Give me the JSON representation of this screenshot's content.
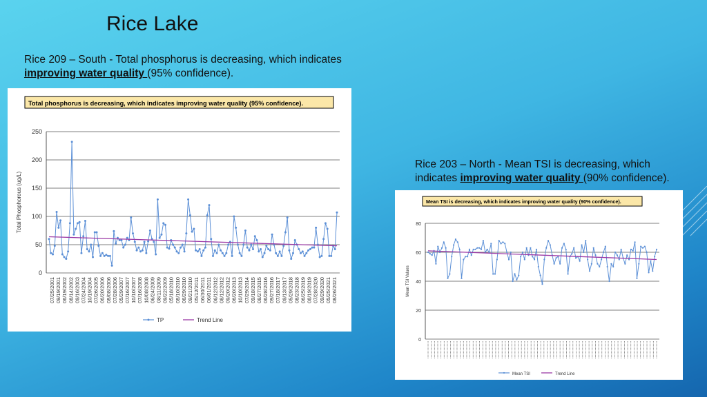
{
  "title": "Rice Lake",
  "caption_left": {
    "prefix": "Rice 209 – South - Total phosphorus is decreasing, which indicates ",
    "emphasis": "improving water quality ",
    "suffix": "(95% confidence)."
  },
  "caption_right": {
    "prefix": "Rice 203 – North - Mean TSI is decreasing, which indicates ",
    "emphasis": "improving water quality ",
    "suffix": "(90% confidence)."
  },
  "colors": {
    "series": "#5b8fd6",
    "trend": "#9b3aa6",
    "grid": "#555555",
    "box_fill": "#fbe7a8"
  },
  "chart_data": [
    {
      "type": "line",
      "title": "Total phosphorus is decreasing, which indicates improving water quality (95% confidence).",
      "ylabel": "Total Phosphorous (ug/L)",
      "xlabel": "",
      "ylim": [
        0,
        250
      ],
      "yticks": [
        0,
        50,
        100,
        150,
        200,
        250
      ],
      "grid": true,
      "legend_position": "bottom",
      "categories": [
        "07/25/2001",
        "09/19/2001",
        "06/19/2002",
        "08/14/2002",
        "09/16/2003",
        "07/24/2004",
        "10/19/2004",
        "07/26/2005",
        "06/20/2006",
        "08/08/2006",
        "07/28/2006",
        "05/29/2007",
        "07/16/2007",
        "10/10/2007",
        "07/16/2008",
        "10/08/2008",
        "06/24/2009",
        "08/11/2009",
        "09/22/2009",
        "05/18/2010",
        "08/10/2010",
        "06/29/2010",
        "09/21/2010",
        "05/12/2011",
        "06/30/2011",
        "06/01/2011",
        "06/12/2012",
        "08/12/2012",
        "09/20/2012",
        "06/20/2013",
        "10/10/2013",
        "07/29/2014",
        "09/18/2015",
        "08/27/2015",
        "06/28/2016",
        "09/27/2016",
        "07/18/2017",
        "09/13/2017",
        "05/29/2018",
        "08/23/2018",
        "06/25/2019",
        "08/19/2019",
        "07/28/2020",
        "09/29/2020",
        "05/25/2021",
        "08/26/2021"
      ],
      "series": [
        {
          "name": "TP",
          "values": [
            60,
            35,
            33,
            48,
            108,
            80,
            93,
            33,
            28,
            25,
            38,
            88,
            232,
            68,
            78,
            88,
            90,
            35,
            65,
            92,
            42,
            38,
            50,
            28,
            72,
            72,
            48,
            30,
            35,
            30,
            32,
            30,
            30,
            13,
            74,
            52,
            62,
            58,
            58,
            45,
            50,
            62,
            58,
            98,
            70,
            55,
            40,
            45,
            38,
            40,
            55,
            35,
            56,
            75,
            60,
            55,
            33,
            130,
            62,
            68,
            88,
            85,
            45,
            43,
            58,
            50,
            45,
            38,
            35,
            45,
            50,
            38,
            70,
            130,
            102,
            73,
            78,
            40,
            38,
            42,
            30,
            40,
            45,
            102,
            120,
            60,
            30,
            40,
            35,
            50,
            40,
            35,
            30,
            35,
            50,
            55,
            30,
            100,
            80,
            50,
            35,
            30,
            50,
            75,
            45,
            40,
            50,
            42,
            65,
            58,
            38,
            42,
            28,
            35,
            48,
            42,
            40,
            68,
            50,
            35,
            30,
            38,
            30,
            48,
            72,
            98,
            40,
            25,
            35,
            58,
            50,
            42,
            35,
            38,
            30,
            35,
            40,
            42,
            45,
            45,
            80,
            50,
            28,
            30,
            60,
            88,
            78,
            30,
            30,
            48,
            42,
            107
          ]
        },
        {
          "name": "Trend Line",
          "values": [
            64,
            48
          ]
        }
      ]
    },
    {
      "type": "line",
      "title": "Mean TSI is decreasing, which indicates improving water quality (90% confidence).",
      "ylabel": "Mean TSI Values",
      "xlabel": "",
      "ylim": [
        0,
        80
      ],
      "yticks": [
        0,
        20,
        40,
        60,
        80
      ],
      "grid": true,
      "legend_position": "bottom",
      "series": [
        {
          "name": "Mean TSI",
          "values": [
            60,
            59,
            58,
            61,
            52,
            64,
            60,
            63,
            67,
            63,
            42,
            45,
            57,
            65,
            69,
            67,
            62,
            42,
            55,
            57,
            57,
            62,
            58,
            62,
            62,
            63,
            63,
            62,
            68,
            60,
            62,
            60,
            66,
            45,
            45,
            55,
            68,
            66,
            67,
            66,
            60,
            55,
            60,
            40,
            45,
            41,
            44,
            57,
            60,
            55,
            63,
            58,
            63,
            57,
            55,
            62,
            50,
            44,
            38,
            55,
            63,
            68,
            65,
            58,
            52,
            56,
            57,
            52,
            63,
            66,
            62,
            45,
            57,
            59,
            63,
            56,
            57,
            54,
            65,
            60,
            68,
            55,
            47,
            52,
            63,
            58,
            52,
            50,
            55,
            60,
            64,
            50,
            40,
            52,
            50,
            60,
            58,
            55,
            62,
            56,
            52,
            58,
            55,
            62,
            61,
            67,
            42,
            52,
            64,
            63,
            64,
            60,
            46,
            54,
            47,
            57,
            62
          ]
        },
        {
          "name": "Trend Line",
          "values": [
            61,
            55
          ]
        }
      ]
    }
  ]
}
